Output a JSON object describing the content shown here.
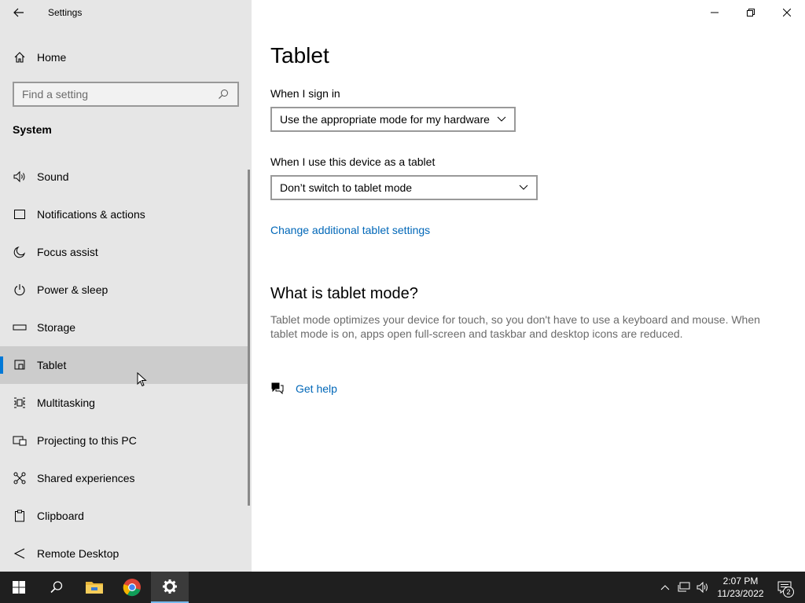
{
  "window": {
    "title": "Settings",
    "back_icon": "back-arrow-icon",
    "controls": [
      "minimize-icon",
      "restore-icon",
      "close-icon"
    ]
  },
  "sidebar": {
    "home_label": "Home",
    "search_placeholder": "Find a setting",
    "section": "System",
    "items": [
      {
        "label": "Sound",
        "icon": "speaker-icon"
      },
      {
        "label": "Notifications & actions",
        "icon": "notification-icon"
      },
      {
        "label": "Focus assist",
        "icon": "moon-icon"
      },
      {
        "label": "Power & sleep",
        "icon": "power-icon"
      },
      {
        "label": "Storage",
        "icon": "storage-icon"
      },
      {
        "label": "Tablet",
        "icon": "tablet-icon",
        "active": true
      },
      {
        "label": "Multitasking",
        "icon": "multitasking-icon"
      },
      {
        "label": "Projecting to this PC",
        "icon": "projecting-icon"
      },
      {
        "label": "Shared experiences",
        "icon": "shared-experiences-icon"
      },
      {
        "label": "Clipboard",
        "icon": "clipboard-icon"
      },
      {
        "label": "Remote Desktop",
        "icon": "remote-desktop-icon"
      }
    ]
  },
  "main": {
    "title": "Tablet",
    "sign_in_label": "When I sign in",
    "sign_in_value": "Use the appropriate mode for my hardware",
    "tablet_label": "When I use this device as a tablet",
    "tablet_value": "Don’t switch to tablet mode",
    "additional_link": "Change additional tablet settings",
    "what_is_heading": "What is tablet mode?",
    "what_is_text": "Tablet mode optimizes your device for touch, so you don't have to use a keyboard and mouse. When tablet mode is on, apps open full-screen and taskbar and desktop icons are reduced.",
    "help_label": "Get help"
  },
  "taskbar": {
    "time": "2:07 PM",
    "date": "11/23/2022",
    "notification_count": "2",
    "accent": "#76b9ed"
  }
}
